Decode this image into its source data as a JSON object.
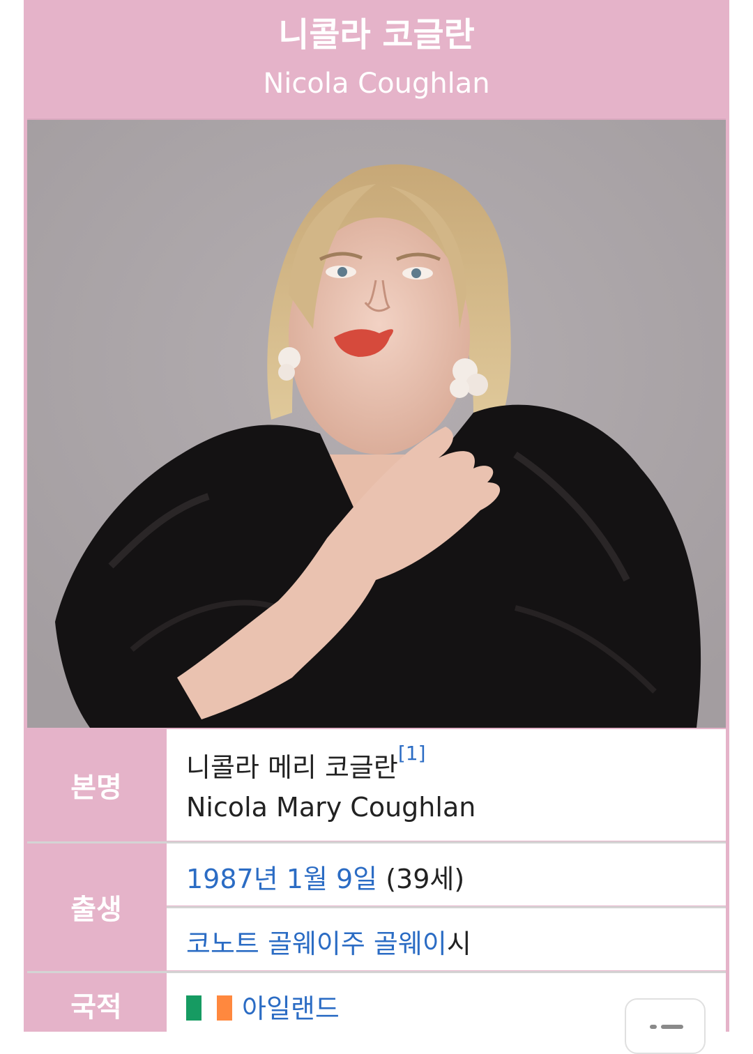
{
  "header": {
    "title_ko": "니콜라 코글란",
    "title_en": "Nicola Coughlan"
  },
  "photo": {
    "alt": "Nicola Coughlan"
  },
  "rows": {
    "real_name": {
      "label": "본명",
      "name_ko": "니콜라 메리 코글란",
      "ref": "[1]",
      "name_en": "Nicola Mary Coughlan"
    },
    "birth": {
      "label": "출생",
      "date_year": "1987년",
      "date_month": "1월",
      "date_day": "9일",
      "age": "(39세)",
      "place_region": "코노트",
      "place_county": "골웨이주",
      "place_city": "골웨이",
      "place_suffix": "시"
    },
    "nationality": {
      "label": "국적",
      "country": "아일랜드",
      "flag_colors": [
        "#169b62",
        "#ffffff",
        "#ff883e"
      ]
    }
  },
  "colors": {
    "accent": "#e5b3c9",
    "link": "#2b6cc4"
  },
  "toc_button": {
    "icon": "list-icon"
  }
}
